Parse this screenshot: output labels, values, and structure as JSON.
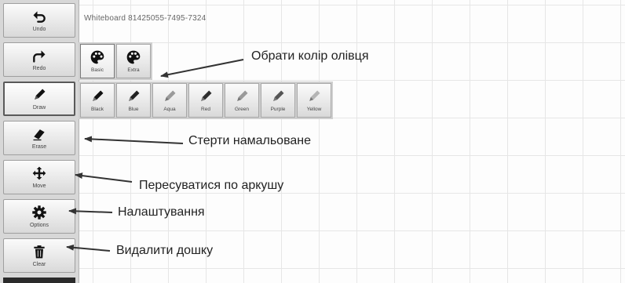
{
  "board": {
    "title": "Whiteboard 81425055-7495-7324"
  },
  "toolbar": {
    "undo": {
      "label": "Undo",
      "icon": "undo-icon"
    },
    "redo": {
      "label": "Redo",
      "icon": "redo-icon"
    },
    "draw": {
      "label": "Draw",
      "icon": "pencil-icon"
    },
    "erase": {
      "label": "Erase",
      "icon": "eraser-icon"
    },
    "move": {
      "label": "Move",
      "icon": "move-arrows-icon"
    },
    "options": {
      "label": "Options",
      "icon": "gear-icon"
    },
    "clear": {
      "label": "Clear",
      "icon": "trash-icon"
    }
  },
  "palettes": [
    {
      "label": "Basic",
      "icon": "palette-icon",
      "selected": true
    },
    {
      "label": "Extra",
      "icon": "palette-icon",
      "selected": false
    }
  ],
  "colors": [
    {
      "label": "Black",
      "hex": "#111111"
    },
    {
      "label": "Blue",
      "hex": "#222222"
    },
    {
      "label": "Aqua",
      "hex": "#9a9a9a"
    },
    {
      "label": "Red",
      "hex": "#2e2e2e"
    },
    {
      "label": "Green",
      "hex": "#9a9a9a"
    },
    {
      "label": "Purple",
      "hex": "#555555"
    },
    {
      "label": "Yellow",
      "hex": "#b5b5b5"
    }
  ],
  "annotations": {
    "pick_color": "Обрати колір олівця",
    "erase": "Стерти намальоване",
    "move": "Пересуватися по аркушу",
    "settings": "Налаштування",
    "clear": "Видалити дошку"
  }
}
